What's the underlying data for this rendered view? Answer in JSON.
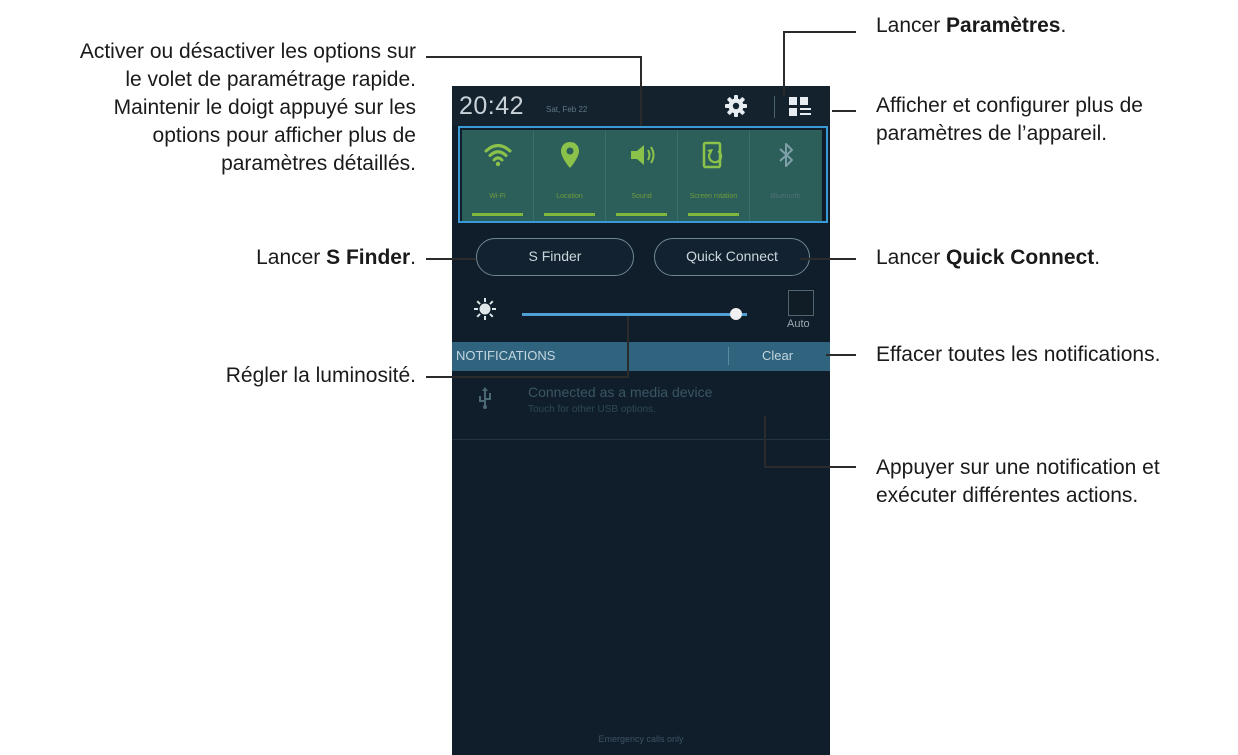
{
  "statusbar": {
    "time": "20:42",
    "date": "Sat, Feb 22"
  },
  "quick_settings": [
    {
      "label": "Wi-Fi",
      "icon": "wifi-icon"
    },
    {
      "label": "Location",
      "icon": "location-pin-icon"
    },
    {
      "label": "Sound",
      "icon": "speaker-icon"
    },
    {
      "label": "Screen rotation",
      "icon": "screen-rotation-icon"
    },
    {
      "label": "Bluetooth",
      "icon": "bluetooth-icon"
    }
  ],
  "buttons": {
    "s_finder": "S Finder",
    "quick_connect": "Quick Connect"
  },
  "brightness": {
    "level": 0.95,
    "auto_label": "Auto"
  },
  "notifications": {
    "header": "NOTIFICATIONS",
    "clear": "Clear",
    "items": [
      {
        "title": "Connected as a media device",
        "subtitle": "Touch for other USB options."
      }
    ]
  },
  "footer": {
    "emergency": "Emergency calls only"
  },
  "annotations": {
    "settings": {
      "prefix": "Lancer ",
      "bold": "Paramètres",
      "suffix": "."
    },
    "more_settings": [
      "Afficher et configurer plus de",
      "paramètres de l’appareil."
    ],
    "quick_options": [
      "Activer ou désactiver les options sur",
      "le volet de paramétrage rapide.",
      "Maintenir le doigt appuyé sur les",
      "options pour afficher plus de",
      "paramètres détaillés."
    ],
    "s_finder": {
      "prefix": "Lancer ",
      "bold": "S Finder",
      "suffix": "."
    },
    "quick_connect": {
      "prefix": "Lancer ",
      "bold": "Quick Connect",
      "suffix": "."
    },
    "brightness": "Régler la luminosité.",
    "clear_all": "Effacer toutes les notifications.",
    "notification": [
      "Appuyer sur une notification et",
      "exécuter différentes actions."
    ]
  },
  "colors": {
    "accent_blue": "#3a9ad6",
    "tile_green": "#2d5f5a",
    "icon_green": "#8bc34a",
    "notif_header": "#30647e"
  }
}
